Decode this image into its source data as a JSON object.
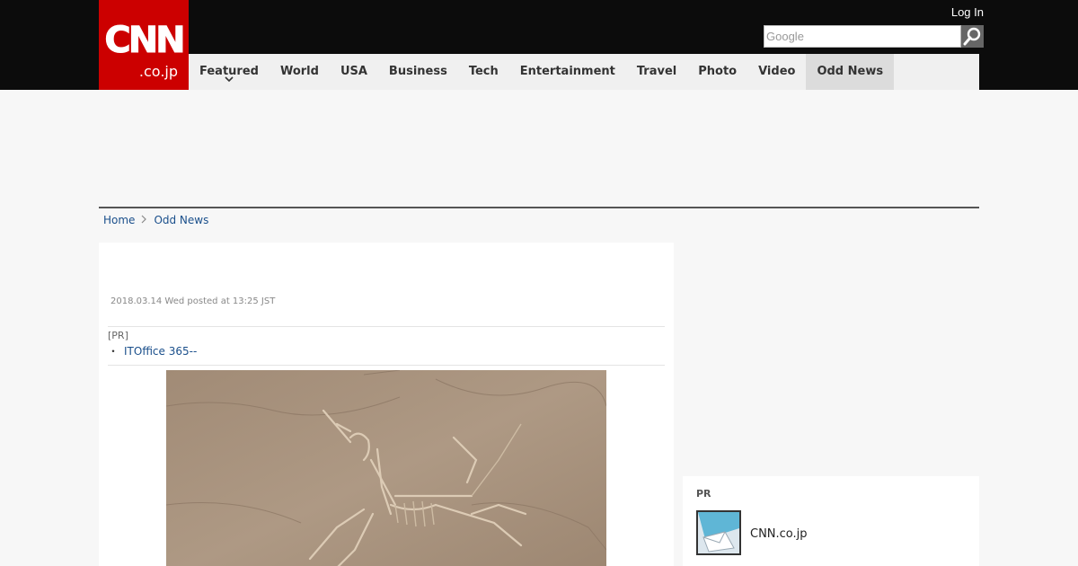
{
  "header": {
    "logo_main": "CNN",
    "logo_sub": ".co.jp",
    "login_label": "Log In",
    "search_placeholder": "Google"
  },
  "nav": {
    "items": [
      "Featured",
      "World",
      "USA",
      "Business",
      "Tech",
      "Entertainment",
      "Travel",
      "Photo",
      "Video",
      "Odd News"
    ],
    "active": "Odd News"
  },
  "breadcrumb": {
    "home": "Home",
    "current": "Odd News"
  },
  "article": {
    "posted": "2018.03.14 Wed posted at 13:25 JST",
    "pr_label": "[PR]",
    "pr_bullet": "・",
    "pr_link": "ITOffice 365--"
  },
  "sidebar": {
    "pr_heading": "PR",
    "item_text": "CNN.co.jp"
  },
  "colors": {
    "brand_red": "#cc0000",
    "topbar": "#0c0c0c",
    "link_blue": "#1a4f8b",
    "nav_active_bg": "#dcdcdc"
  }
}
